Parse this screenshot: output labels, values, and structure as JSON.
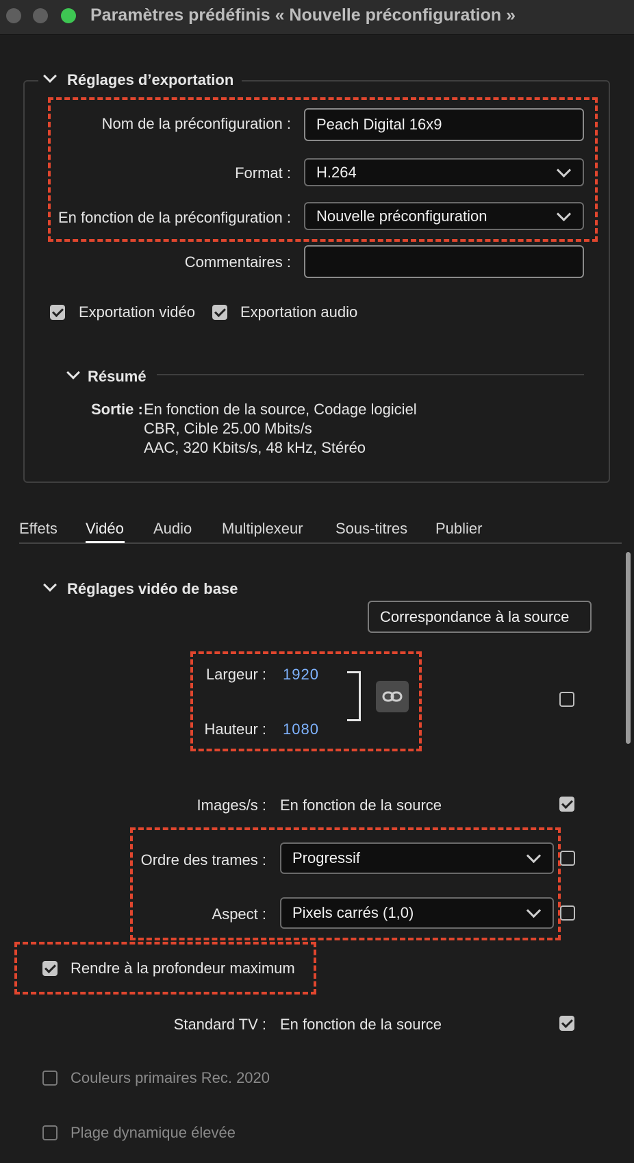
{
  "window": {
    "title": "Paramètres prédéfinis « Nouvelle préconfiguration »",
    "traffic_lights": [
      "#5e5e5e",
      "#5e5e5e",
      "#3ec653"
    ]
  },
  "export_settings": {
    "heading": "Réglages d’exportation",
    "preset_name_label": "Nom de la préconfiguration :",
    "preset_name_value": "Peach Digital 16x9",
    "format_label": "Format :",
    "format_value": "H.264",
    "based_on_label": "En fonction de la préconfiguration :",
    "based_on_value": "Nouvelle préconfiguration",
    "comments_label": "Commentaires :",
    "comments_value": "",
    "export_video_label": "Exportation vidéo",
    "export_video_checked": true,
    "export_audio_label": "Exportation audio",
    "export_audio_checked": true
  },
  "summary": {
    "heading": "Résumé",
    "output_label": "Sortie :",
    "output_lines": [
      "En fonction de la source, Codage logiciel",
      "CBR, Cible 25.00  Mbits/s",
      "AAC, 320  Kbits/s, 48 kHz, Stéréo"
    ]
  },
  "tabs": [
    "Effets",
    "Vidéo",
    "Audio",
    "Multiplexeur",
    "Sous-titres",
    "Publier"
  ],
  "active_tab": "Vidéo",
  "video": {
    "heading": "Réglages vidéo de base",
    "match_source_button": "Correspondance à la source",
    "width_label": "Largeur :",
    "width_value": "1920",
    "height_label": "Hauteur :",
    "height_value": "1080",
    "fps_label": "Images/s :",
    "fps_value": "En fonction de la source",
    "field_order_label": "Ordre des trames :",
    "field_order_value": "Progressif",
    "aspect_label": "Aspect :",
    "aspect_value": "Pixels carrés (1,0)",
    "max_depth_label": "Rendre à la profondeur maximum",
    "max_depth_checked": true,
    "tv_standard_label": "Standard TV :",
    "tv_standard_value": "En fonction de la source",
    "rec2020_label": "Couleurs primaires Rec. 2020",
    "rec2020_checked": false,
    "hdr_label": "Plage dynamique élevée",
    "hdr_checked": false,
    "checkboxes": {
      "size_match": false,
      "fps_match": true,
      "field_order_match": false,
      "aspect_match": false,
      "tv_standard_match": true
    }
  },
  "colors": {
    "highlight": "#e0462e",
    "link_value": "#7fb3ff",
    "background": "#1d1d1d"
  },
  "icons": {
    "link": "link-icon"
  }
}
